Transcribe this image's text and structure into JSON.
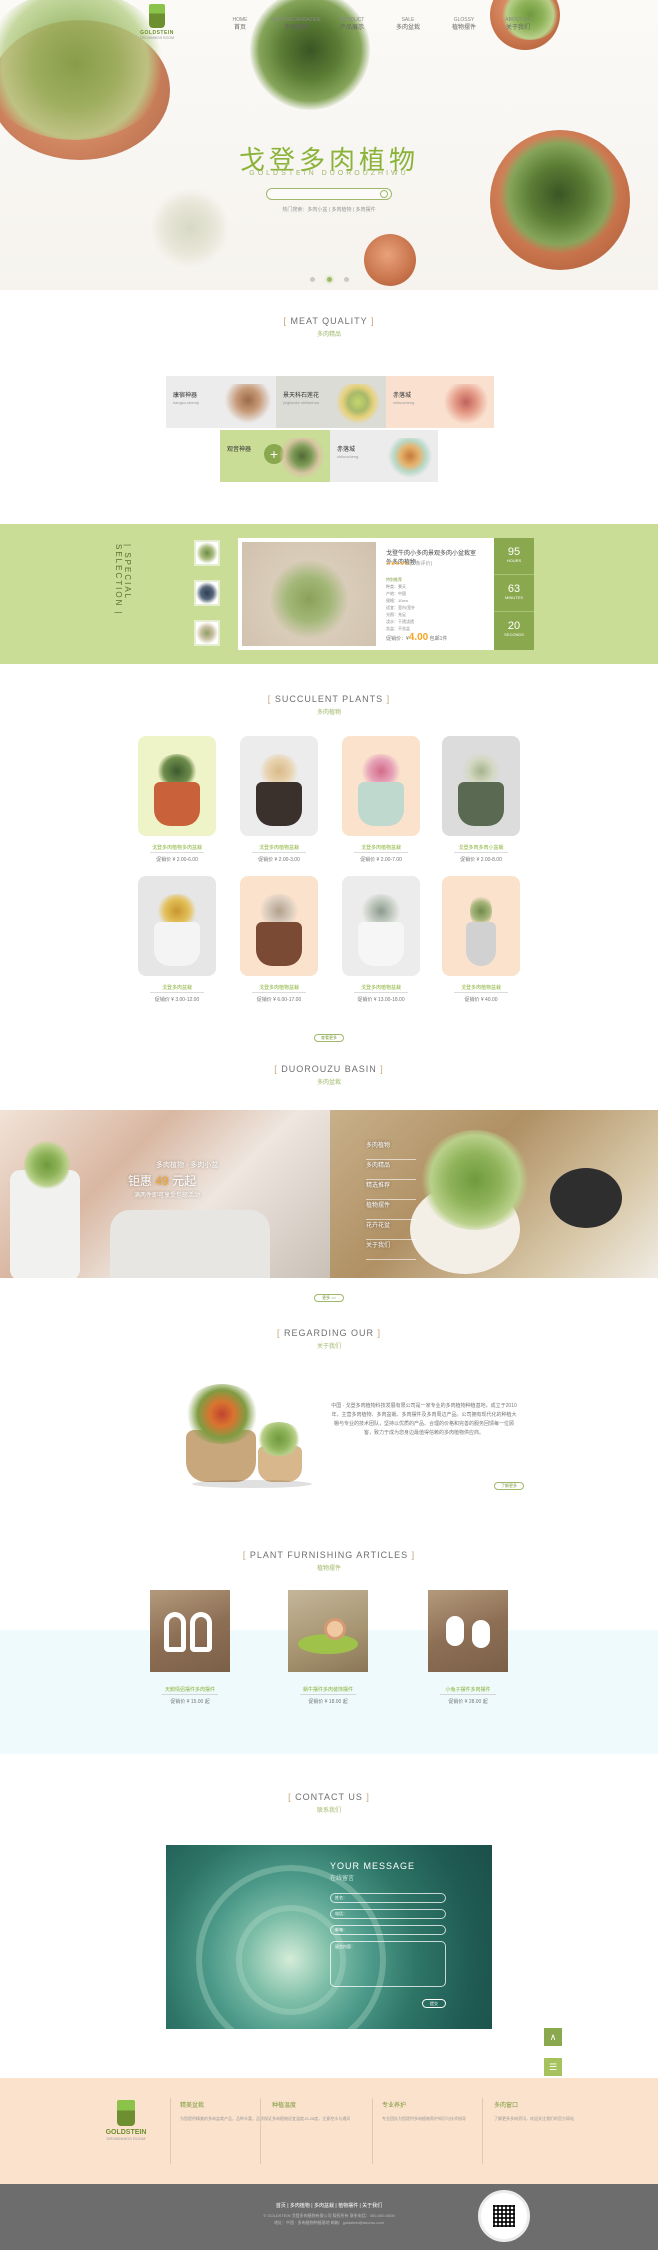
{
  "brand": {
    "name": "GOLDSTEIN",
    "sub": "DROWNHIGS ROOM"
  },
  "nav": [
    {
      "cn": "首页",
      "en": "HOME"
    },
    {
      "cn": "多肉植物",
      "en": "MULTISECARBAZIDE"
    },
    {
      "cn": "产品展示",
      "en": "PRODUCT"
    },
    {
      "cn": "多肉盆栽",
      "en": "SALE"
    },
    {
      "cn": "植物摆件",
      "en": "GLOSSY"
    },
    {
      "cn": "关于我们",
      "en": "ABOUT US"
    }
  ],
  "hero": {
    "title": "戈登多肉植物",
    "subtitle": "GOLDSTEIN DUOROUZHIWU",
    "tags": "热门搜索：多肉小盆 | 多肉植物 | 多肉摆件"
  },
  "meat_quality": {
    "title_en": "MEAT QUALITY",
    "title_cn": "多肉精品",
    "tiles": [
      {
        "label": "康宿神器",
        "sub": "kangsu shenqi"
      },
      {
        "label": "景天科石莲花",
        "sub": "jingtianke shilianhua"
      },
      {
        "label": "赤落城",
        "sub": "chiluocheng"
      },
      {
        "label": "观音神器",
        "sub": "guanyin shenqi"
      },
      {
        "label": "赤落城",
        "sub": "chiluocheng"
      }
    ]
  },
  "special": {
    "label": "SPECIAL SELECTION",
    "label_cn": "特别推荐",
    "title": "戈登牛肉小多肉景观多肉小盆栽室外多肉植物",
    "stars": "★★★★★",
    "review": "(3 条评价)",
    "info": [
      "种类：景天",
      "产地：中国",
      "规格：10cm",
      "适宜：室内/室外",
      "光照：充足",
      "浇水：干透浇透",
      "含盆：不含盆"
    ],
    "price_label": "促销价：¥",
    "price": "4.00",
    "price_tail": "包邮1件",
    "stats": [
      {
        "n": "95",
        "u": "HOURS"
      },
      {
        "n": "63",
        "u": "MINUTES"
      },
      {
        "n": "20",
        "u": "SECONDS"
      }
    ]
  },
  "succulent": {
    "title_en": "SUCCULENT PLANTS",
    "title_cn": "多肉植物",
    "products": [
      {
        "name": "戈登多肉植物多肉盆栽",
        "price": "促销价 ¥ 2.00-6.00"
      },
      {
        "name": "戈登多肉植物盆栽",
        "price": "促销价 ¥ 2.00-3.00"
      },
      {
        "name": "戈登多肉植物盆栽",
        "price": "促销价 ¥ 2.00-7.00"
      },
      {
        "name": "戈登多肉多肉小盆栽",
        "price": "促销价 ¥ 2.00-8.00"
      },
      {
        "name": "戈登多肉盆栽",
        "price": "促销价 ¥ 3.00-12.00"
      },
      {
        "name": "戈登多肉植物盆栽",
        "price": "促销价 ¥ 6.00-17.00"
      },
      {
        "name": "戈登多肉植物盆栽",
        "price": "促销价 ¥ 13.00-18.00"
      },
      {
        "name": "戈登多肉植物盆栽",
        "price": "促销价 ¥ 40.00"
      }
    ],
    "more": "查看更多"
  },
  "basin": {
    "title_en": "DUOROUZU BASIN",
    "title_cn": "多肉盆栽",
    "promo_lines": [
      "多肉植物 · 多肉小盆",
      "钜惠",
      "49",
      "元起",
      "满两件即可享受包邮活动"
    ],
    "menu": [
      "多肉植物",
      "多肉精品",
      "精选推荐",
      "植物摆件",
      "花卉花盆",
      "关于我们"
    ],
    "more": "更多 >>"
  },
  "about": {
    "title_en": "REGARDING OUR",
    "title_cn": "关于我们",
    "text": "中国 · 戈登多肉植物科技发展有限公司是一家专业的多肉植物种植基地，成立于2010年，主营多肉植物、多肉盆栽、多肉摆件及多肉周边产品。公司拥有现代化的种植大棚与专业的技术团队，坚持以优质的产品、合理的价格和完善的服务回馈每一位顾客，致力于成为您身边最值得信赖的多肉植物供应商。",
    "more": "了解更多"
  },
  "articles": {
    "title_en": "PLANT FURNISHING ARTICLES",
    "title_cn": "植物摆件",
    "items": [
      {
        "name": "天鹅情侣摆件多肉摆件",
        "price": "促销价 ¥ 15.00 起"
      },
      {
        "name": "蜗牛摆件多肉装饰摆件",
        "price": "促销价 ¥ 18.00 起"
      },
      {
        "name": "小兔子摆件多肉摆件",
        "price": "促销价 ¥ 28.00 起"
      }
    ]
  },
  "contact": {
    "title_en": "CONTACT US",
    "title_cn": "联系我们",
    "form_title": "YOUR MESSAGE",
    "form_cn": "在线留言",
    "fields": [
      "姓名：",
      "电话：",
      "邮箱："
    ],
    "message_placeholder": "留言内容：",
    "send": "提交"
  },
  "footer": {
    "brand": "GOLDSTEIN",
    "brand_sub": "DROWNHIGS ROOM",
    "cols": [
      {
        "h": "精美盆栽",
        "b": "为您提供精美的多肉盆栽产品，品种丰富，品质保证"
      },
      {
        "h": "种植温度",
        "b": "多肉植物适宜温度15-28度，注意控水与通风"
      },
      {
        "h": "专业养护",
        "b": "专业团队为您提供多肉植物养护知识与技术指导"
      },
      {
        "h": "多肉窗口",
        "b": "了解更多多肉资讯，欢迎关注我们的官方网站"
      }
    ],
    "links": "首页 | 多肉植物 | 多肉盆栽 | 植物摆件 | 关于我们",
    "copy1": "© GOLDSTEIN 戈登多肉植物有限公司 版权所有 联系电话：400-000-0000",
    "copy2": "地址：中国 · 多肉植物种植基地 邮箱：goldstein@duorou.com"
  },
  "float": {
    "up": "∧",
    "cart": "☰"
  }
}
